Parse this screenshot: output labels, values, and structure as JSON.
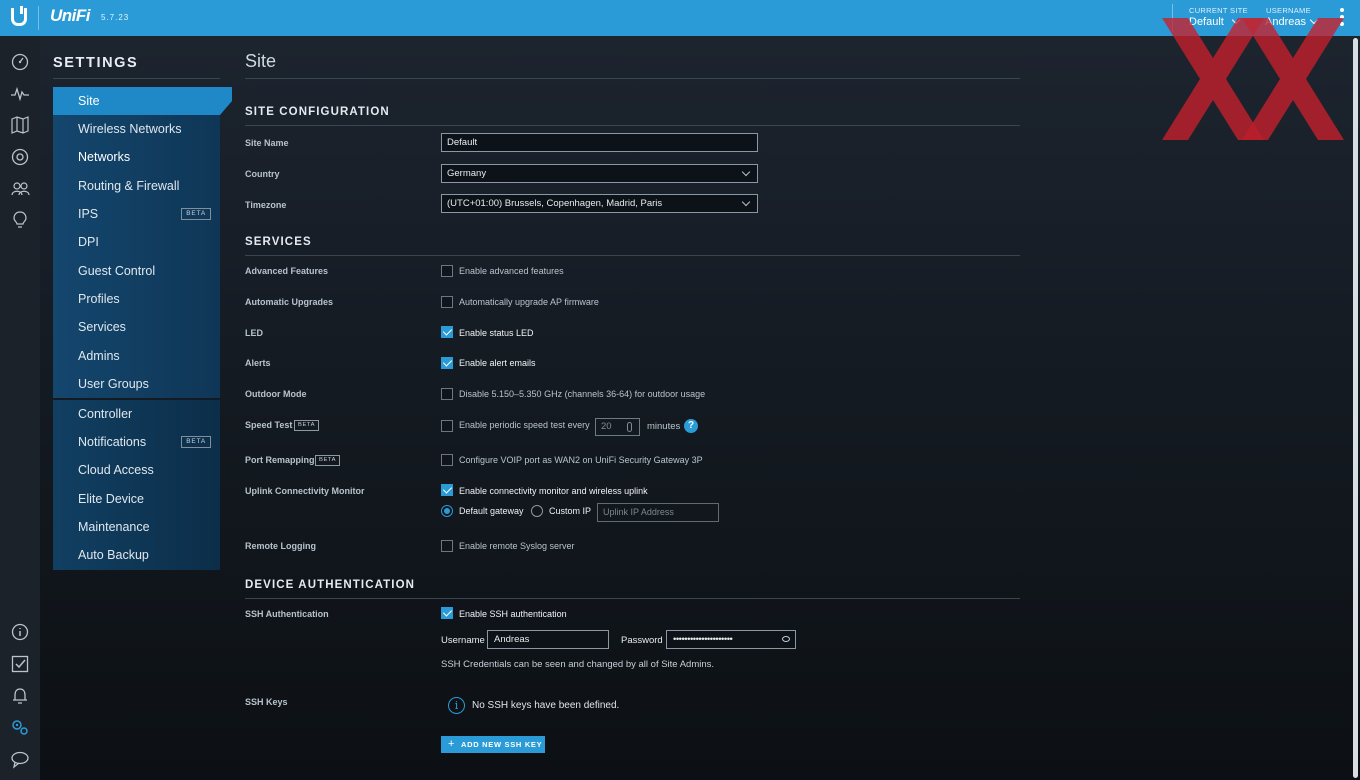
{
  "topbar": {
    "brand": "UniFi",
    "version": "5.7.23",
    "current_site_label": "CURRENT SITE",
    "current_site_value": "Default",
    "username_label": "USERNAME",
    "username_value": "Andreas"
  },
  "colors": {
    "accent": "#2b9bd7",
    "sidebar": "#14466e",
    "background": "#151b23"
  },
  "rail_icons": [
    "dashboard-icon",
    "statistics-icon",
    "map-icon",
    "devices-icon",
    "clients-icon",
    "insights-icon",
    "info-icon",
    "tasks-icon",
    "alerts-icon",
    "settings-icon",
    "chat-icon"
  ],
  "settings": {
    "title": "SETTINGS",
    "menu": [
      {
        "label": "Site"
      },
      {
        "label": "Wireless Networks"
      },
      {
        "label": "Networks"
      },
      {
        "label": "Routing & Firewall"
      },
      {
        "label": "IPS",
        "badge": "BETA"
      },
      {
        "label": "DPI"
      },
      {
        "label": "Guest Control"
      },
      {
        "label": "Profiles"
      },
      {
        "label": "Services"
      },
      {
        "label": "Admins"
      },
      {
        "label": "User Groups"
      },
      {
        "label": "Controller"
      },
      {
        "label": "Notifications",
        "badge": "BETA"
      },
      {
        "label": "Cloud Access"
      },
      {
        "label": "Elite Device"
      },
      {
        "label": "Maintenance"
      },
      {
        "label": "Auto Backup"
      }
    ]
  },
  "page": {
    "title": "Site",
    "site_config": {
      "heading": "SITE CONFIGURATION",
      "site_name_label": "Site Name",
      "site_name_value": "Default",
      "country_label": "Country",
      "country_value": "Germany",
      "timezone_label": "Timezone",
      "timezone_value": "(UTC+01:00) Brussels, Copenhagen, Madrid, Paris"
    },
    "services": {
      "heading": "SERVICES",
      "rows": [
        {
          "label": "Advanced Features",
          "text": "Enable advanced features",
          "checked": false
        },
        {
          "label": "Automatic Upgrades",
          "text": "Automatically upgrade AP firmware",
          "checked": false
        },
        {
          "label": "LED",
          "text": "Enable status LED",
          "checked": true
        },
        {
          "label": "Alerts",
          "text": "Enable alert emails",
          "checked": true
        },
        {
          "label": "Outdoor Mode",
          "text": "Disable 5.150–5.350 GHz (channels 36-64) for outdoor usage",
          "checked": false
        },
        {
          "label": "Speed Test",
          "badge": "BETA",
          "text": "Enable periodic speed test every",
          "checked": false
        },
        {
          "label": "Port Remapping",
          "badge": "BETA",
          "text": "Configure VOIP port as WAN2 on UniFi Security Gateway 3P",
          "checked": false
        },
        {
          "label": "Uplink Connectivity Monitor",
          "text": "Enable connectivity monitor and wireless uplink",
          "checked": true
        },
        {
          "label": "Remote Logging",
          "text": "Enable remote Syslog server",
          "checked": false
        }
      ],
      "speed_test_interval": "20",
      "speed_test_unit": "minutes",
      "help": "?",
      "uplink_default_gateway": "Default gateway",
      "uplink_custom_ip": "Custom IP",
      "uplink_ip_placeholder": "Uplink IP Address"
    },
    "device_auth": {
      "heading": "DEVICE AUTHENTICATION",
      "ssh_auth_label": "SSH Authentication",
      "ssh_auth_text": "Enable SSH authentication",
      "ssh_auth_checked": true,
      "username_label": "Username",
      "username_value": "Andreas",
      "password_label": "Password",
      "password_value": "•••••••••••••••••••••",
      "credentials_note": "SSH Credentials can be seen and changed by all of Site Admins.",
      "ssh_keys_label": "SSH Keys",
      "no_keys_text": "No SSH keys have been defined.",
      "info_glyph": "i",
      "add_button": "ADD NEW SSH KEY"
    }
  }
}
